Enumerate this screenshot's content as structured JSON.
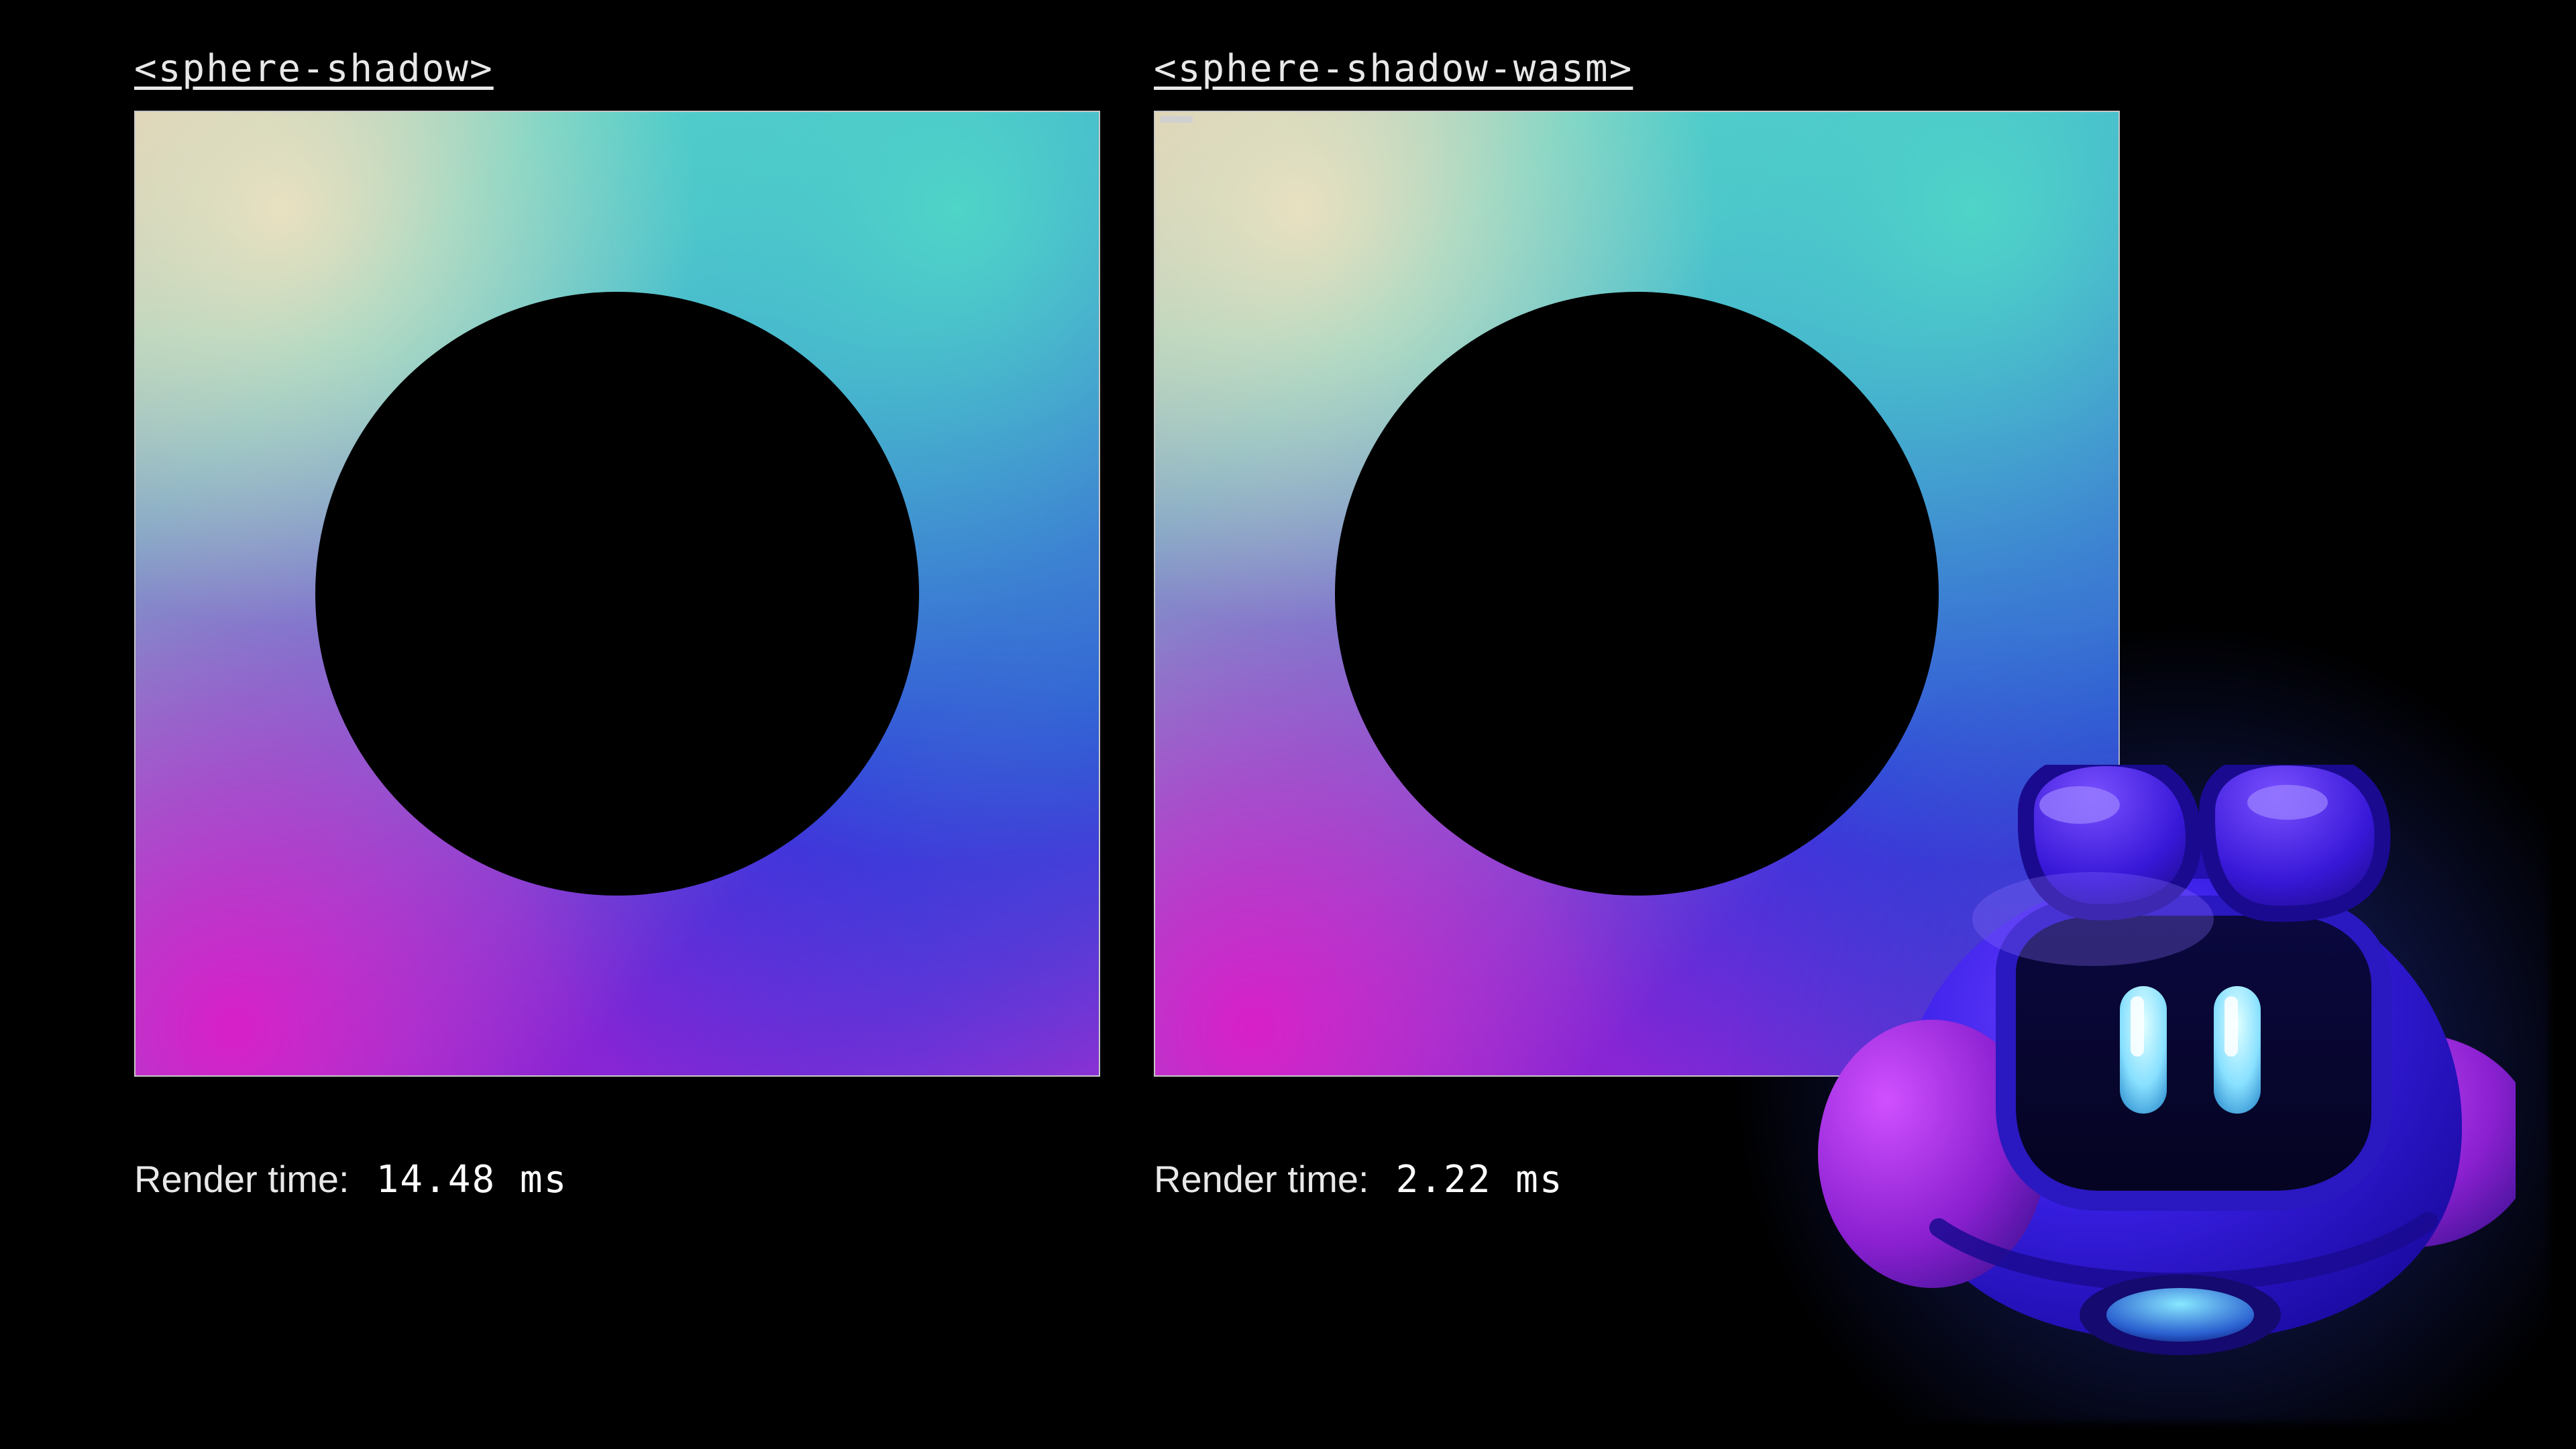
{
  "panels": [
    {
      "title": "<sphere-shadow>",
      "render_label": "Render time:",
      "render_value": "14.48 ms",
      "has_cursor_mark": false
    },
    {
      "title": "<sphere-shadow-wasm>",
      "render_label": "Render time:",
      "render_value": "2.22 ms",
      "has_cursor_mark": true
    }
  ],
  "mascot": {
    "name": "robot-mascot",
    "body_color": "#3a20e8",
    "accent_color": "#c028e0",
    "eye_color": "#a0e8ff",
    "glow_color": "#2860ff"
  }
}
